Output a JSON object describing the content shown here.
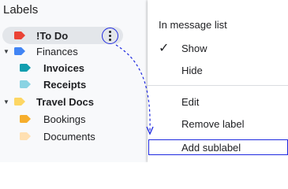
{
  "labels_panel": {
    "title": "Labels",
    "items": [
      {
        "name": "!To Do",
        "color": "#ea4335",
        "bold": true
      },
      {
        "name": "Finances",
        "color": "#4285f4",
        "bold": false
      },
      {
        "name": "Invoices",
        "color": "#129eaf",
        "bold": true
      },
      {
        "name": "Receipts",
        "color": "#8ad3e3",
        "bold": true
      },
      {
        "name": "Travel Docs",
        "color": "#fdd663",
        "bold": true
      },
      {
        "name": "Bookings",
        "color": "#f6ae2d",
        "bold": false
      },
      {
        "name": "Documents",
        "color": "#ffe0b2",
        "bold": false
      }
    ]
  },
  "menu": {
    "header": "In message list",
    "show": "Show",
    "hide": "Hide",
    "edit": "Edit",
    "remove_label": "Remove label",
    "add_sublabel": "Add sublabel"
  },
  "accent": "#1f2ae0"
}
